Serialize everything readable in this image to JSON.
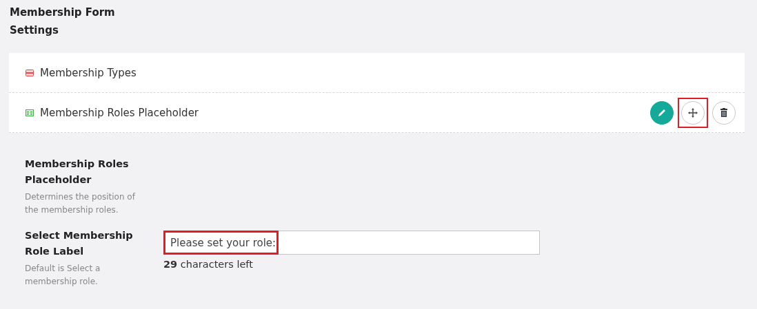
{
  "title": "Membership Form Settings",
  "fields": [
    {
      "kind": "types",
      "label": "Membership Types",
      "actions": false
    },
    {
      "kind": "roles",
      "label": "Membership Roles Placeholder",
      "actions": true
    }
  ],
  "actions": [
    {
      "kind": "edit",
      "highlighted": false
    },
    {
      "kind": "move",
      "highlighted": true
    },
    {
      "kind": "delete",
      "highlighted": false
    }
  ],
  "settings": [
    {
      "kind": "info",
      "label": "Membership Roles Placeholder",
      "help": "Determines the position of the membership roles."
    },
    {
      "kind": "text",
      "label": "Select Membership Role Label",
      "help": "Default is Select a membership role.",
      "value": "Please set your role:",
      "highlighted": true,
      "counter": "**29** characters left"
    }
  ]
}
